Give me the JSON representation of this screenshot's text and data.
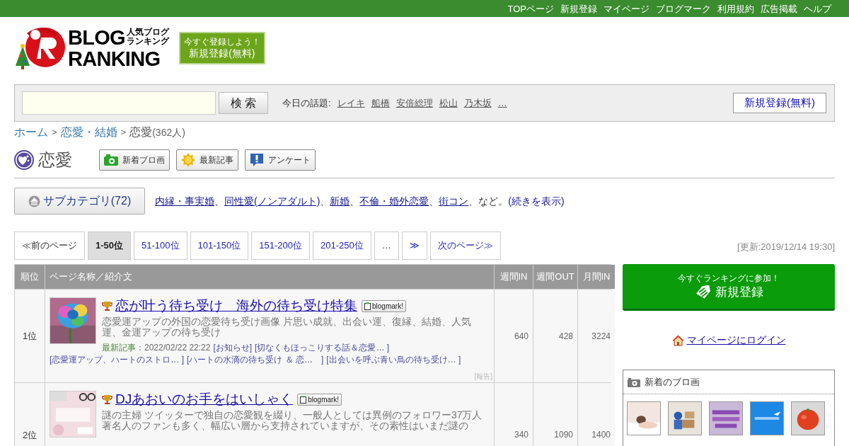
{
  "top_nav": [
    "TOPページ",
    "新規登録",
    "マイページ",
    "ブログマーク",
    "利用規約",
    "広告掲載",
    "ヘルプ"
  ],
  "logo": {
    "line1": "BLOG",
    "line2": "RANKING",
    "sub1": "人気ブログ",
    "sub2": "ランキング"
  },
  "signup_banner": {
    "caption": "今すぐ登録しよう！",
    "label": "新規登録(無料)"
  },
  "search": {
    "button": "検 索",
    "topics_label": "今日の話題:",
    "topics": [
      "レイキ",
      "船橋",
      "安倍総理",
      "松山",
      "乃木坂",
      "…"
    ],
    "signup": "新規登録(無料)"
  },
  "breadcrumb": {
    "items": [
      "ホーム",
      "恋愛・結婚",
      "恋愛"
    ],
    "separator": ">",
    "count": "(362人)"
  },
  "category": {
    "title": "恋愛",
    "actions": [
      {
        "kind": "camera",
        "label": "新着ブロ画"
      },
      {
        "kind": "new",
        "label": "最新記事"
      },
      {
        "kind": "survey",
        "label": "アンケート"
      }
    ]
  },
  "subcategory": {
    "button": "サブカテゴリ(72)",
    "links": [
      "内縁・事実婚",
      "同性愛(ノンアダルト)",
      "新婚",
      "不倫・婚外恋愛",
      "街コン"
    ],
    "separator": "、",
    "suffix": "、など。",
    "more": "(続きを表示)"
  },
  "pagination": [
    {
      "label": "≪前のページ",
      "selected": false,
      "disabled": true
    },
    {
      "label": "1-50位",
      "selected": true,
      "disabled": false
    },
    {
      "label": "51-100位",
      "selected": false,
      "disabled": false
    },
    {
      "label": "101-150位",
      "selected": false,
      "disabled": false
    },
    {
      "label": "151-200位",
      "selected": false,
      "disabled": false
    },
    {
      "label": "201-250位",
      "selected": false,
      "disabled": false
    },
    {
      "label": "…",
      "selected": false,
      "disabled": true
    },
    {
      "label": "≫",
      "selected": false,
      "disabled": false
    },
    {
      "label": "次のページ≫",
      "selected": false,
      "disabled": false
    }
  ],
  "updated": "[更新:2019/12/14 19:30]",
  "table": {
    "columns": [
      "順位",
      "ページ名称／紹介文",
      "週間IN",
      "週間OUT",
      "月間IN"
    ],
    "rows": [
      {
        "rank": "1位",
        "title": "恋が叶う待ち受け　海外の待ち受け特集",
        "badge": "blogmark!",
        "description": "恋愛運アップの外国の恋愛待ち受け画像 片思い成就、出会い運、復縁、結婚、人気運、金運アップの待ち受け",
        "latest_label": "最新記事",
        "latest_date": "：2022/02/22 22:22",
        "articles": [
          "[お知らせ]",
          "[切なくもほっこりする話＆恋愛… ]",
          "[恋愛運アップ、ハートのストロ… ]",
          "[ハートの水滴の待ち受け ＆ 恋…　]",
          "[出会いを呼ぶ青い鳥の待ち受け… ]"
        ],
        "report": "[報告]",
        "weekly_in": "640",
        "weekly_out": "428",
        "monthly_in": "3224"
      },
      {
        "rank": "2位",
        "title": "DJあおいのお手をはいしゃく",
        "badge": "blogmark!",
        "description": "謎の主婦 ツイッターで独自の恋愛観を綴り、一般人としては異例のフォロワー37万人著名人のファンも多く、幅広い層から支持されていますが、その素性はいまだ謎の",
        "weekly_in": "340",
        "weekly_out": "1090",
        "monthly_in": "1400"
      }
    ]
  },
  "sidebar": {
    "join": {
      "caption": "今すぐランキングに参加！",
      "label": "新規登録"
    },
    "login": "マイページにログイン",
    "new_images": {
      "title": "新着のブロ画"
    }
  }
}
